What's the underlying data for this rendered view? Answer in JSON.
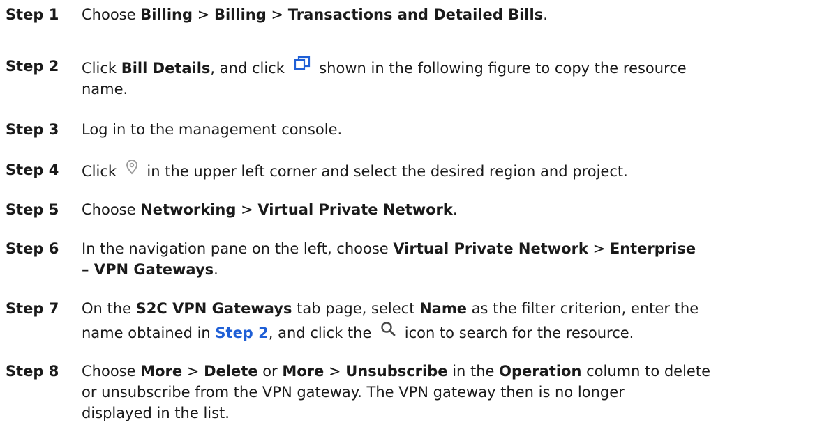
{
  "steps": [
    {
      "label": "Step 1",
      "t1": "Choose ",
      "b1": "Billing",
      "t2": " > ",
      "b2": "Billing",
      "t3": " > ",
      "b3": "Transactions and Detailed Bills",
      "t4": "."
    },
    {
      "label": "Step 2",
      "t1": "Click ",
      "b1": "Bill Details",
      "t2": ", and click ",
      "icon": "copy-icon",
      "t3": " shown in the following figure to copy the resource",
      "t4": "name."
    },
    {
      "label": "Step 3",
      "t1": "Log in to the management console."
    },
    {
      "label": "Step 4",
      "t1": "Click ",
      "icon": "location-pin-icon",
      "t2": " in the upper left corner and select the desired region and project."
    },
    {
      "label": "Step 5",
      "t1": "Choose ",
      "b1": "Networking",
      "t2": " > ",
      "b2": "Virtual Private Network",
      "t3": "."
    },
    {
      "label": "Step 6",
      "t1": "In the navigation pane on the left, choose ",
      "b1": "Virtual Private Network",
      "t2": " > ",
      "b2": "Enterprise",
      "b3": "– VPN Gateways",
      "t3": "."
    },
    {
      "label": "Step 7",
      "t1": "On the ",
      "b1": "S2C VPN Gateways",
      "t2": " tab page, select ",
      "b2": "Name",
      "t3": " as the filter criterion, enter the",
      "t4": "name obtained in ",
      "link": "Step 2",
      "t5": ", and click the ",
      "icon": "search-icon",
      "t6": " icon to search for the resource."
    },
    {
      "label": "Step 8",
      "t1": "Choose ",
      "b1": "More",
      "t2": " > ",
      "b2": "Delete",
      "t3": " or ",
      "b3": "More",
      "t4": " > ",
      "b4": "Unsubscribe",
      "t5": " in the ",
      "b5": "Operation",
      "t6": " column to delete",
      "t7": "or unsubscribe from the VPN gateway. The VPN gateway then is no longer",
      "t8": "displayed in the list."
    }
  ],
  "colors": {
    "text": "#1a1a1a",
    "link": "#1f5fd6",
    "icon_blue": "#1f5fd6",
    "icon_gray": "#9a9a9a",
    "icon_dark": "#4a4a4a"
  }
}
